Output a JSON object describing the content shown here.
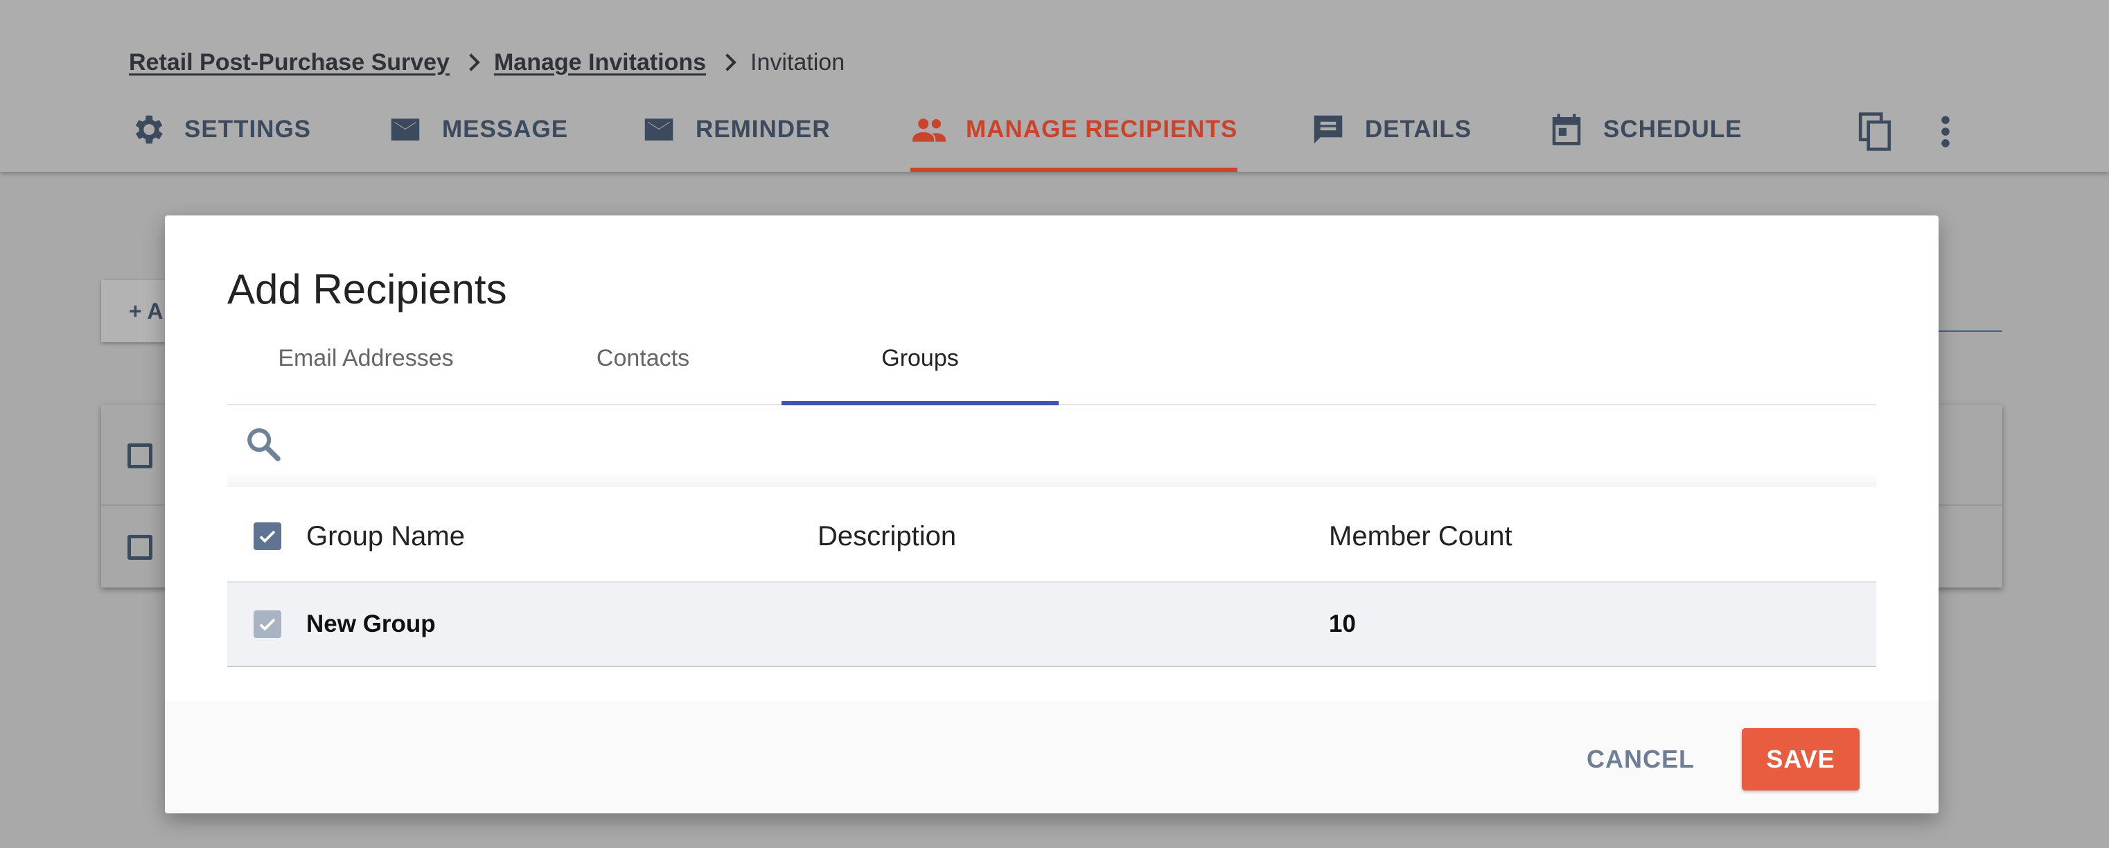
{
  "colors": {
    "accent": "#c9442b",
    "tab_indicator": "#3f51b5",
    "save": "#e85d3f",
    "overlay": "#a9a9a9"
  },
  "breadcrumb": {
    "items": [
      "Retail Post-Purchase Survey",
      "Manage Invitations"
    ],
    "current": "Invitation"
  },
  "nav": {
    "tabs": [
      {
        "label": "SETTINGS",
        "icon": "gear-icon",
        "active": false
      },
      {
        "label": "MESSAGE",
        "icon": "envelope-icon",
        "active": false
      },
      {
        "label": "REMINDER",
        "icon": "envelope-icon",
        "active": false
      },
      {
        "label": "MANAGE RECIPIENTS",
        "icon": "people-icon",
        "active": true
      },
      {
        "label": "DETAILS",
        "icon": "message-list-icon",
        "active": false
      },
      {
        "label": "SCHEDULE",
        "icon": "calendar-icon",
        "active": false
      }
    ],
    "actions": [
      "copy-icon",
      "more-vertical-icon"
    ]
  },
  "background": {
    "add_button_label": "+ A"
  },
  "modal": {
    "title": "Add Recipients",
    "tabs": [
      {
        "label": "Email Addresses",
        "active": false
      },
      {
        "label": "Contacts",
        "active": false
      },
      {
        "label": "Groups",
        "active": true
      }
    ],
    "search": {
      "value": "",
      "placeholder": ""
    },
    "table": {
      "columns": [
        "Group Name",
        "Description",
        "Member Count"
      ],
      "header_checked": true,
      "rows": [
        {
          "name": "New Group",
          "description": "",
          "member_count": "10",
          "checked": true
        }
      ]
    },
    "buttons": {
      "cancel": "CANCEL",
      "save": "SAVE"
    }
  }
}
